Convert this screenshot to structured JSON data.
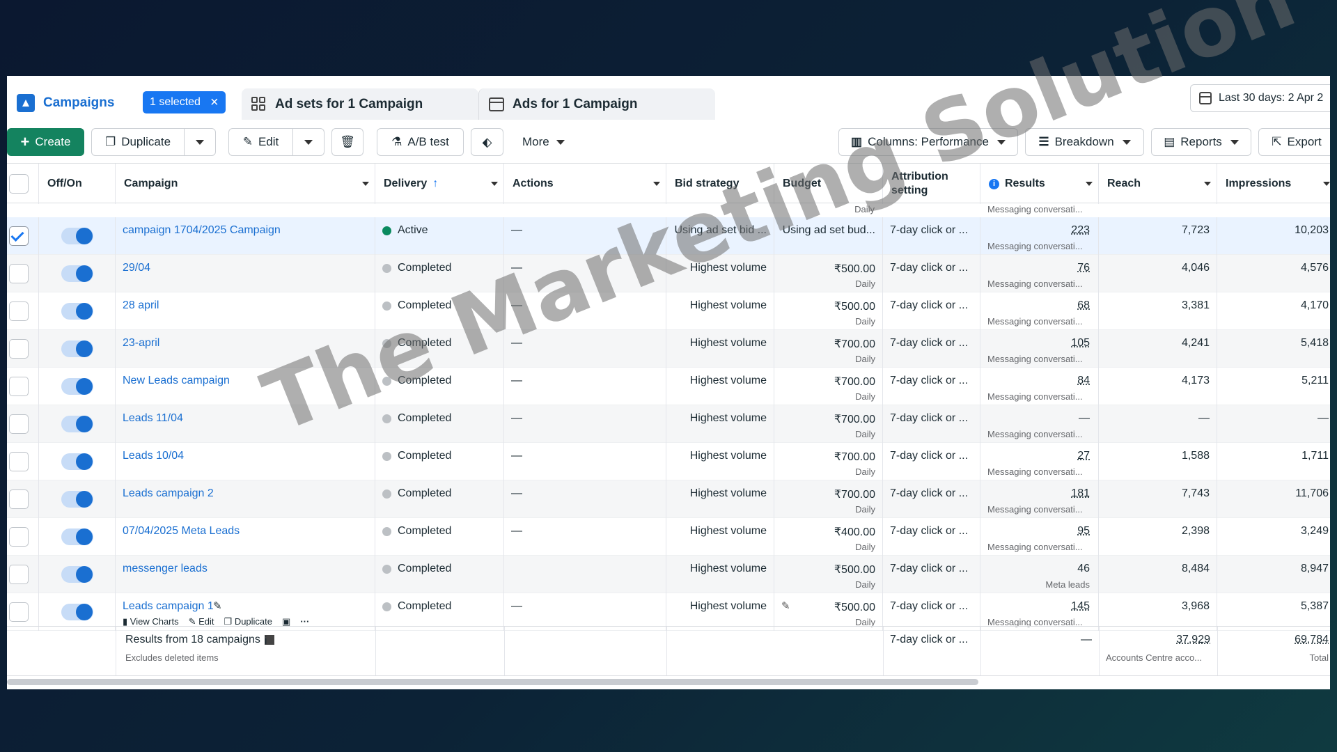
{
  "tabs": {
    "campaigns": "Campaigns",
    "selected": "1 selected",
    "adsets": "Ad sets for 1 Campaign",
    "ads": "Ads for 1 Campaign",
    "date": "Last 30 days: 2 Apr 2"
  },
  "toolbar": {
    "create": "Create",
    "duplicate": "Duplicate",
    "edit": "Edit",
    "abtest": "A/B test",
    "more": "More",
    "columns": "Columns: Performance",
    "breakdown": "Breakdown",
    "reports": "Reports",
    "export": "Export"
  },
  "columns": {
    "onoff": "Off/On",
    "campaign": "Campaign",
    "delivery": "Delivery",
    "actions": "Actions",
    "bid": "Bid strategy",
    "budget": "Budget",
    "attr1": "Attribution",
    "attr2": "setting",
    "results": "Results",
    "reach": "Reach",
    "impressions": "Impressions"
  },
  "top_partial": {
    "budget_sub": "Daily",
    "results_sub": "Messaging conversati..."
  },
  "rows": [
    {
      "name": "campaign 1704/2025 Campaign",
      "delivery": "Active",
      "actions": "—",
      "bid": "Using ad set bid ...",
      "budget": "Using ad set bud...",
      "budget_sub": "",
      "attr": "7-day click or ...",
      "results": "223",
      "results_sub": "Messaging conversati...",
      "reach": "7,723",
      "impressions": "10,203"
    },
    {
      "name": "29/04",
      "delivery": "Completed",
      "actions": "—",
      "bid": "Highest volume",
      "budget": "₹500.00",
      "budget_sub": "Daily",
      "attr": "7-day click or ...",
      "results": "76",
      "results_sub": "Messaging conversati...",
      "reach": "4,046",
      "impressions": "4,576"
    },
    {
      "name": "28 april",
      "delivery": "Completed",
      "actions": "—",
      "bid": "Highest volume",
      "budget": "₹500.00",
      "budget_sub": "Daily",
      "attr": "7-day click or ...",
      "results": "68",
      "results_sub": "Messaging conversati...",
      "reach": "3,381",
      "impressions": "4,170"
    },
    {
      "name": "23-april",
      "delivery": "Completed",
      "actions": "—",
      "bid": "Highest volume",
      "budget": "₹700.00",
      "budget_sub": "Daily",
      "attr": "7-day click or ...",
      "results": "105",
      "results_sub": "Messaging conversati...",
      "reach": "4,241",
      "impressions": "5,418"
    },
    {
      "name": "New Leads campaign",
      "delivery": "Completed",
      "actions": "—",
      "bid": "Highest volume",
      "budget": "₹700.00",
      "budget_sub": "Daily",
      "attr": "7-day click or ...",
      "results": "84",
      "results_sub": "Messaging conversati...",
      "reach": "4,173",
      "impressions": "5,211"
    },
    {
      "name": "Leads 11/04",
      "delivery": "Completed",
      "actions": "—",
      "bid": "Highest volume",
      "budget": "₹700.00",
      "budget_sub": "Daily",
      "attr": "7-day click or ...",
      "results": "—",
      "results_sub": "Messaging conversati...",
      "reach": "—",
      "impressions": "—"
    },
    {
      "name": "Leads 10/04",
      "delivery": "Completed",
      "actions": "—",
      "bid": "Highest volume",
      "budget": "₹700.00",
      "budget_sub": "Daily",
      "attr": "7-day click or ...",
      "results": "27",
      "results_sub": "Messaging conversati...",
      "reach": "1,588",
      "impressions": "1,711"
    },
    {
      "name": "Leads campaign 2",
      "delivery": "Completed",
      "actions": "—",
      "bid": "Highest volume",
      "budget": "₹700.00",
      "budget_sub": "Daily",
      "attr": "7-day click or ...",
      "results": "181",
      "results_sub": "Messaging conversati...",
      "reach": "7,743",
      "impressions": "11,706"
    },
    {
      "name": "07/04/2025 Meta Leads",
      "delivery": "Completed",
      "actions": "—",
      "bid": "Highest volume",
      "budget": "₹400.00",
      "budget_sub": "Daily",
      "attr": "7-day click or ...",
      "results": "95",
      "results_sub": "Messaging conversati...",
      "reach": "2,398",
      "impressions": "3,249"
    },
    {
      "name": "messenger leads",
      "delivery": "Completed",
      "actions": "",
      "bid": "Highest volume",
      "budget": "₹500.00",
      "budget_sub": "Daily",
      "attr": "7-day click or ...",
      "results": "46",
      "results_sub": "Meta leads",
      "reach": "8,484",
      "impressions": "8,947"
    },
    {
      "name": "Leads campaign 1",
      "delivery": "Completed",
      "actions": "—",
      "bid": "Highest volume",
      "budget": "₹500.00",
      "budget_sub": "Daily",
      "attr": "7-day click or ...",
      "results": "145",
      "results_sub": "Messaging conversati...",
      "reach": "3,968",
      "impressions": "5,387"
    }
  ],
  "row_actions": {
    "view_charts": "View Charts",
    "edit": "Edit",
    "duplicate": "Duplicate"
  },
  "summary": {
    "title": "Results from 18 campaigns",
    "sub": "Excludes deleted items",
    "attr": "7-day click or ...",
    "results": "—",
    "reach": "37,929",
    "reach_sub": "Accounts Centre acco...",
    "impressions": "69,784",
    "impressions_sub": "Total"
  },
  "watermark": "The Marketing Solution",
  "colors": {
    "accent": "#1877f2",
    "create": "#14835f",
    "active": "#0a8a5f",
    "completed": "#bcc0c4"
  }
}
